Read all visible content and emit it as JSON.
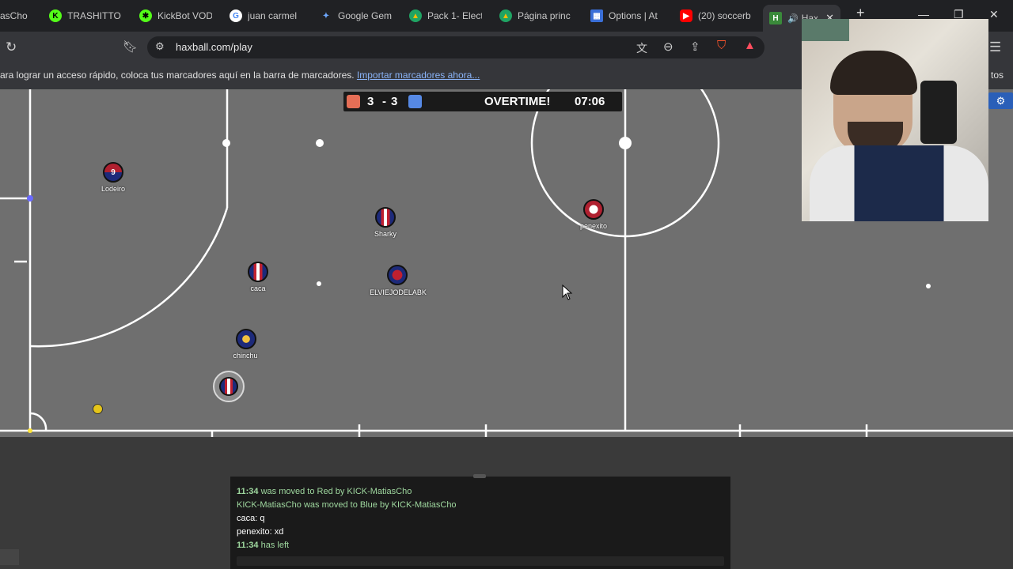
{
  "browser": {
    "tabs": [
      {
        "label": "asCho",
        "icon": "kick-icon",
        "active": false
      },
      {
        "label": "TRASHITTO",
        "icon": "kick-icon",
        "active": false
      },
      {
        "label": "KickBot VOD",
        "icon": "kickbot-icon",
        "active": false
      },
      {
        "label": "juan carmel",
        "icon": "google-icon",
        "active": false
      },
      {
        "label": "Google Gem",
        "icon": "gemini-icon",
        "active": false
      },
      {
        "label": "Pack 1- Elect",
        "icon": "drive-icon",
        "active": false
      },
      {
        "label": "Página princ",
        "icon": "drive-icon",
        "active": false
      },
      {
        "label": "Options | At",
        "icon": "options-icon",
        "active": false
      },
      {
        "label": "(20) soccerb",
        "icon": "youtube-icon",
        "active": false
      },
      {
        "label": "Haxb",
        "icon": "haxball-icon",
        "active": true
      }
    ],
    "new_tab": "+",
    "url": "haxball.com/play",
    "bookmarks_bar_text": "ara lograr un acceso rápido, coloca tus marcadores aquí en la barra de marcadores.",
    "bookmarks_import_link": "Importar marcadores ahora...",
    "bookmarks_right_fragment": "tos"
  },
  "game": {
    "score_red": "3",
    "score_sep": "-",
    "score_blue": "3",
    "status": "OVERTIME!",
    "time": "07:06",
    "red_color": "#e56e56",
    "blue_color": "#5689e5",
    "players": [
      {
        "name": "Lodeiro",
        "number": "9"
      },
      {
        "name": "Sharky",
        "number": ""
      },
      {
        "name": "penexito",
        "number": ""
      },
      {
        "name": "caca",
        "number": ""
      },
      {
        "name": "ELVIEJODELABK",
        "number": ""
      },
      {
        "name": "chinchu",
        "number": ""
      },
      {
        "name": "",
        "number": ""
      }
    ]
  },
  "chat": {
    "lines": [
      {
        "time": "11:34",
        "text": "was moved to Red by KICK-MatiasCho",
        "color": "#9fd89f"
      },
      {
        "time": "",
        "text": "KICK-MatiasCho was moved to Blue by KICK-MatiasCho",
        "color": "#9fd89f"
      },
      {
        "time": "",
        "text": "caca: q",
        "color": "#ffffff"
      },
      {
        "time": "",
        "text": "penexito: xd",
        "color": "#ffffff"
      },
      {
        "time": "11:34",
        "text": "has left",
        "color": "#9fd89f"
      }
    ]
  }
}
